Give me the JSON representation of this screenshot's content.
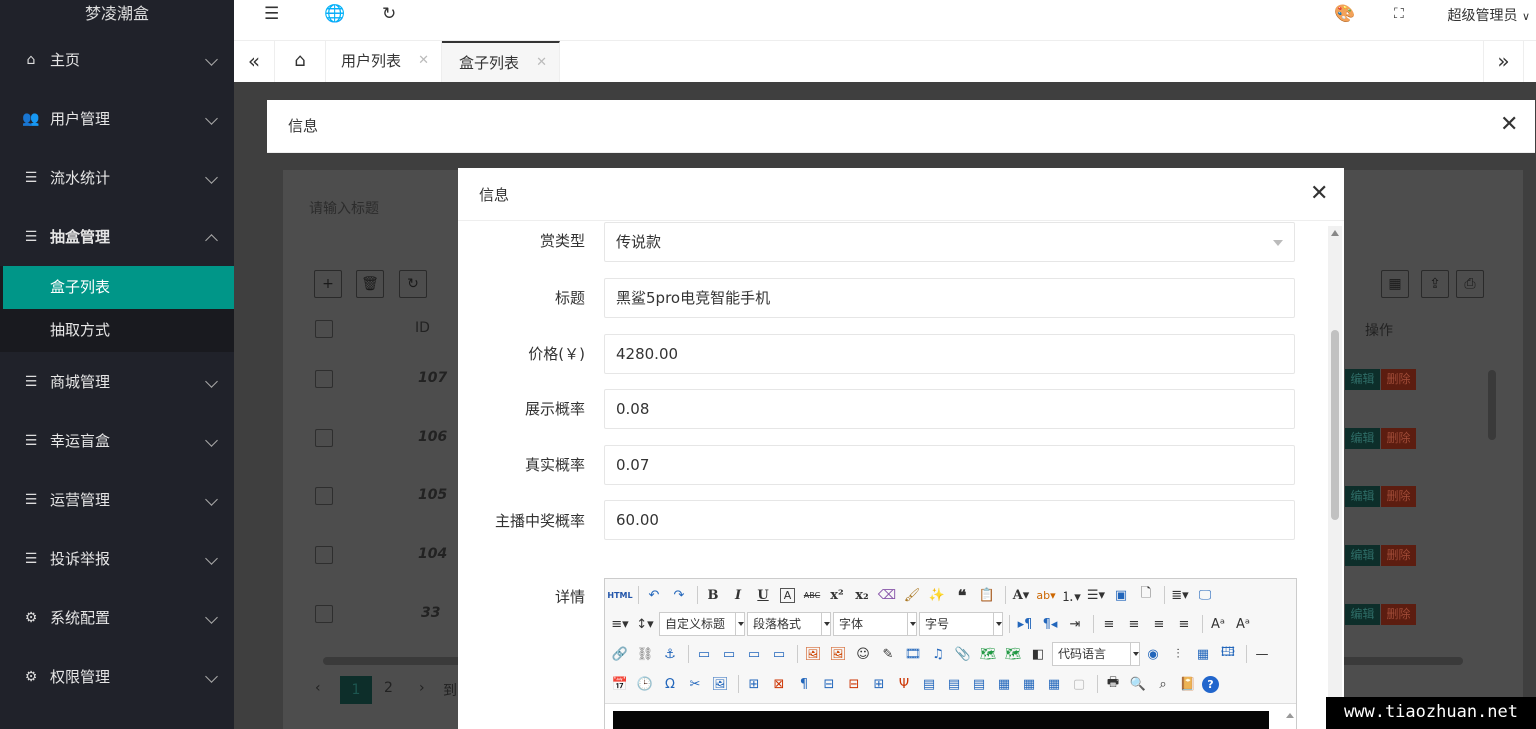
{
  "sidebar": {
    "logo": "梦凌潮盒",
    "items": [
      {
        "label": "主页",
        "icon": "home-icon"
      },
      {
        "label": "用户管理",
        "icon": "users-icon"
      },
      {
        "label": "流水统计",
        "icon": "list-icon"
      },
      {
        "label": "抽盒管理",
        "icon": "list-icon"
      },
      {
        "label": "商城管理",
        "icon": "list-icon"
      },
      {
        "label": "幸运盲盒",
        "icon": "list-icon"
      },
      {
        "label": "运营管理",
        "icon": "list-icon"
      },
      {
        "label": "投诉举报",
        "icon": "list-icon"
      },
      {
        "label": "系统配置",
        "icon": "settings-icon"
      },
      {
        "label": "权限管理",
        "icon": "gear-icon"
      }
    ],
    "subitems": [
      {
        "label": "盒子列表",
        "active": true
      },
      {
        "label": "抽取方式",
        "active": false
      }
    ]
  },
  "topbar": {
    "admin": "超级管理员"
  },
  "tabs": [
    {
      "label": "用户列表"
    },
    {
      "label": "盒子列表"
    }
  ],
  "background": {
    "search_placeholder": "请输入标题",
    "id_header": "ID",
    "op_header": "操作",
    "ids": [
      "107",
      "106",
      "105",
      "104",
      "33"
    ],
    "edit_label": "编辑",
    "delete_label": "删除",
    "pages": [
      "1",
      "2"
    ],
    "page_suffix": "到"
  },
  "outer_dialog": {
    "title": "信息"
  },
  "inner_dialog": {
    "title": "信息",
    "fields": [
      {
        "label": "赏类型",
        "value": "传说款",
        "type": "select"
      },
      {
        "label": "标题",
        "value": "黑鲨5pro电竞智能手机"
      },
      {
        "label": "价格(￥)",
        "value": "4280.00"
      },
      {
        "label": "展示概率",
        "value": "0.08"
      },
      {
        "label": "真实概率",
        "value": "0.07"
      },
      {
        "label": "主播中奖概率",
        "value": "60.00"
      }
    ],
    "detail_label": "详情",
    "editor": {
      "title_select": "自定义标题",
      "paragraph_select": "段落格式",
      "font_select": "字体",
      "size_select": "字号",
      "code_select": "代码语言"
    }
  },
  "watermark": "www.tiaozhuan.net",
  "colors": {
    "sidebar_bg": "#20222a",
    "accent": "#009688",
    "danger": "#ff5722"
  }
}
